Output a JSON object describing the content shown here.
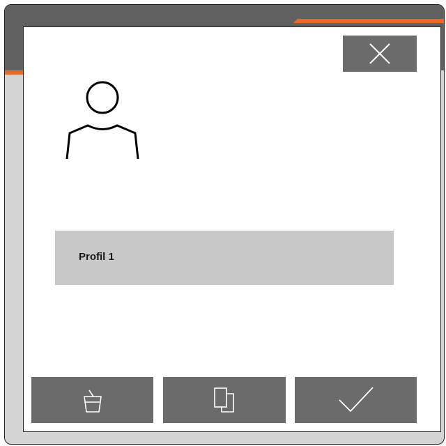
{
  "dialog": {
    "profile_name": "Profil 1"
  },
  "toolbar": {
    "buttons": [
      {
        "id": "delete",
        "icon": "trash-icon"
      },
      {
        "id": "copy",
        "icon": "copy-icon"
      },
      {
        "id": "confirm",
        "icon": "checkmark-icon"
      }
    ]
  },
  "header": {
    "close_icon": "close-icon",
    "profile_icon": "person-icon"
  },
  "colors": {
    "accent": "#e8692a",
    "header": "#606060",
    "button": "#6b6b6b",
    "field": "#c8c8c8",
    "frame": "#d4d4d4"
  }
}
